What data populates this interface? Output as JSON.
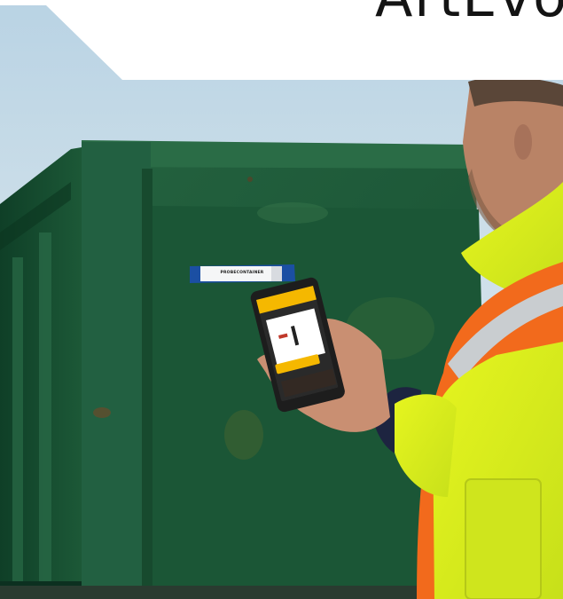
{
  "banner": {
    "title": "ArtEvo"
  },
  "tag": {
    "label": "PROBECONTAINER"
  },
  "colors": {
    "container_green": "#1f5a3a",
    "vest_yellow": "#d9ef1f",
    "vest_orange": "#f26a1c",
    "phone_accent": "#f5b800"
  }
}
